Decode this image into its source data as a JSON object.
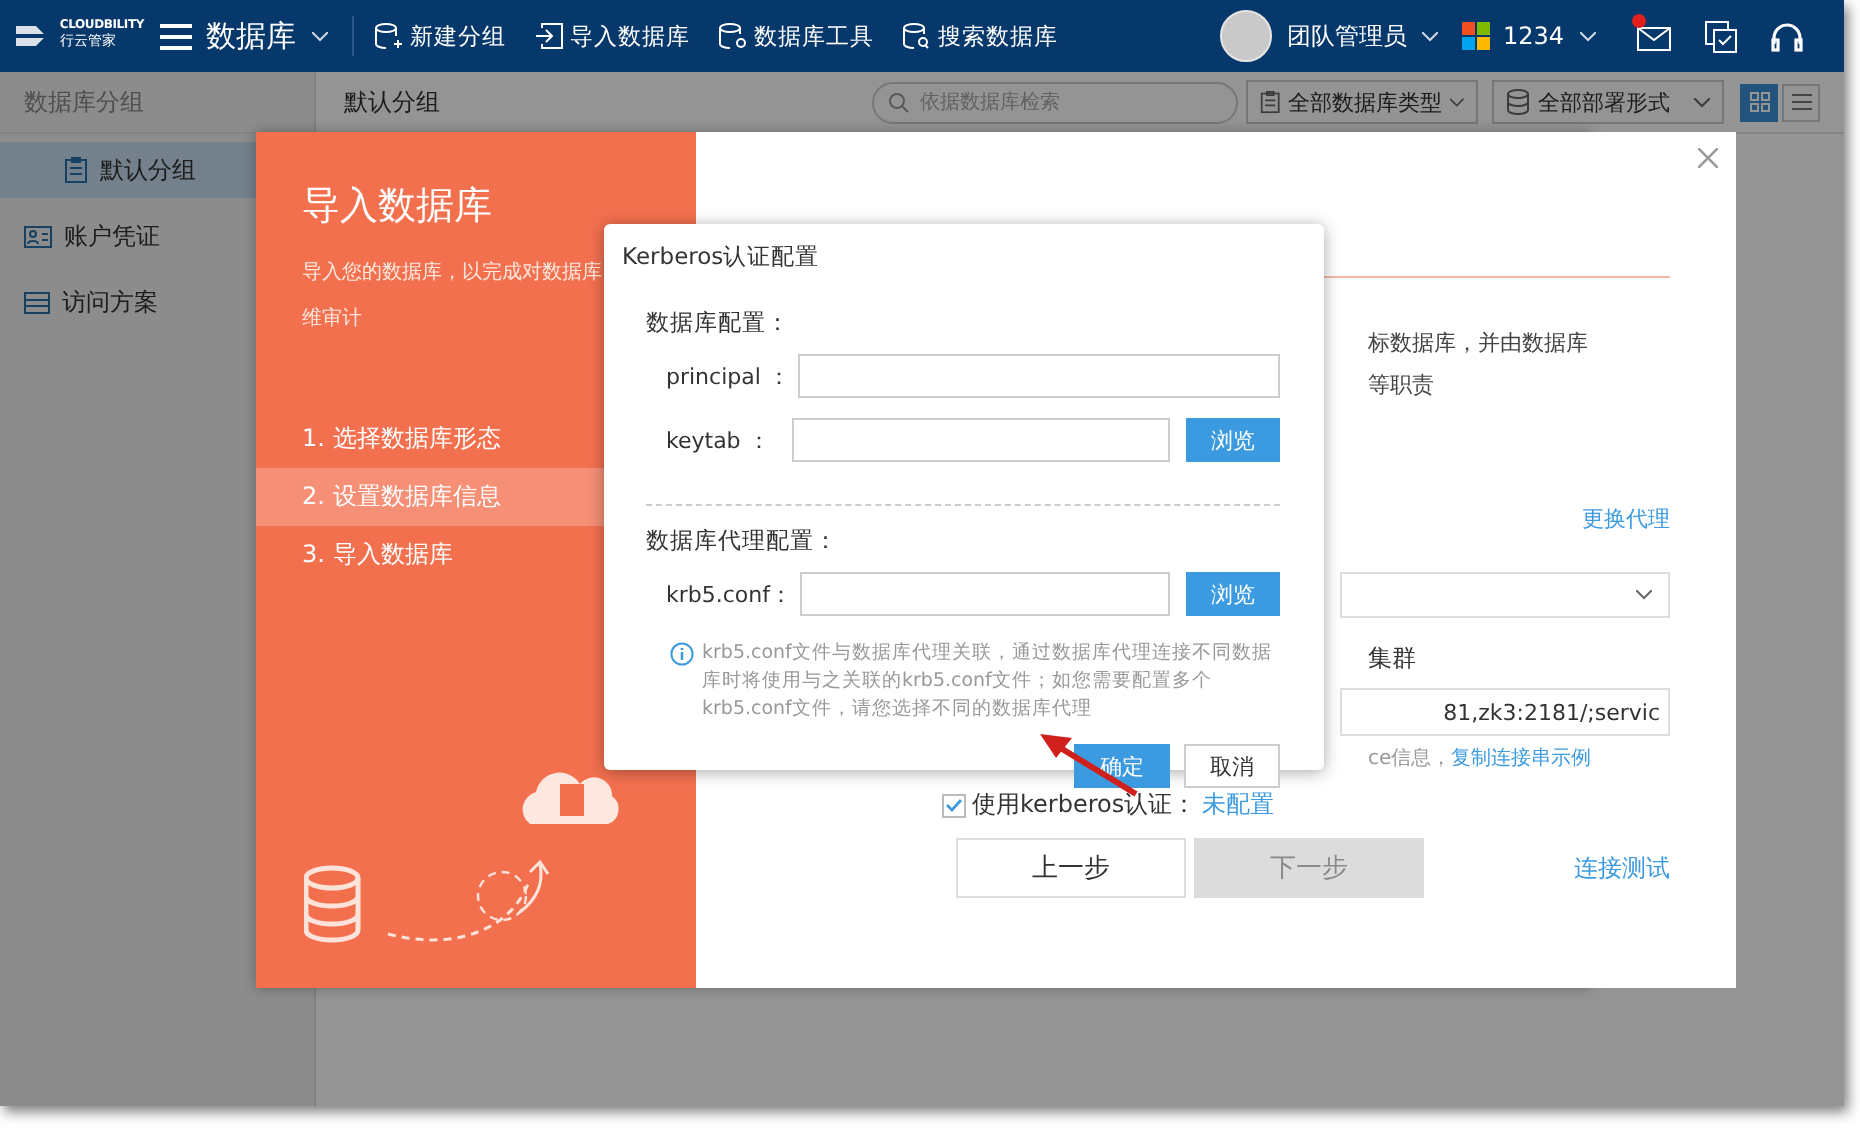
{
  "header": {
    "logo_text": "CLOUDBILITY",
    "logo_subtext": "行云管家",
    "module": "数据库",
    "nav": [
      {
        "kind": "new-group",
        "label": "新建分组"
      },
      {
        "kind": "import",
        "label": "导入数据库"
      },
      {
        "kind": "tools",
        "label": "数据库工具"
      },
      {
        "kind": "search",
        "label": "搜索数据库"
      }
    ],
    "user": "团队管理员",
    "account": "1234",
    "unread": true
  },
  "subbar": {
    "sidebar_title": "数据库分组",
    "group_title": "默认分组",
    "search": {
      "placeholder": "依据数据库检索"
    },
    "filters": [
      {
        "kind": "type",
        "label": "全部数据库类型"
      },
      {
        "kind": "deploy",
        "label": "全部部署形式"
      }
    ],
    "views": [
      {
        "kind": "grid",
        "selected": true
      },
      {
        "kind": "list",
        "selected": false
      }
    ]
  },
  "sidebar": {
    "items": [
      {
        "kind": "group",
        "label": "默认分组",
        "selected": true
      },
      {
        "kind": "credentials",
        "label": "账户凭证",
        "selected": false
      },
      {
        "kind": "access",
        "label": "访问方案",
        "selected": false
      }
    ]
  },
  "wizard": {
    "title": "导入数据库",
    "intro_lines": [
      "导入您的数据库，以完成对数据库",
      "维审计"
    ],
    "steps": [
      {
        "label": "1. 选择数据库形态",
        "selected": false
      },
      {
        "label": "2. 设置数据库信息",
        "selected": true
      },
      {
        "label": "3. 导入数据库",
        "selected": false
      }
    ],
    "partial_lines": [
      "标数据库，并由数据库",
      "等职责"
    ],
    "proxy_link": "更换代理",
    "cluster_label": "集群",
    "connection_value": "81,zk3:2181/;servic",
    "hint_text": "ce信息，",
    "hint_link": "复制连接串示例",
    "kerberos": {
      "checked": true,
      "label": "使用kerberos认证：",
      "link": "未配置"
    },
    "buttons": [
      {
        "label": "上一步",
        "disabled": false
      },
      {
        "label": "下一步",
        "disabled": true
      }
    ],
    "test_link": "连接测试"
  },
  "dialog": {
    "title": "Kerberos认证配置",
    "sections": [
      {
        "title": "数据库配置：",
        "fields": [
          {
            "label": "principal ："
          },
          {
            "label": "keytab ：",
            "browse": "浏览"
          }
        ]
      },
      {
        "title": "数据库代理配置：",
        "fields": [
          {
            "label": "krb5.conf：",
            "browse": "浏览"
          }
        ]
      }
    ],
    "note": "krb5.conf文件与数据库代理关联，通过数据库代理连接不同数据库时将使用与之关联的krb5.conf文件；如您需要配置多个krb5.conf文件，请您选择不同的数据库代理",
    "buttons": [
      {
        "kind": "primary",
        "label": "确定"
      },
      {
        "kind": "secondary",
        "label": "取消"
      }
    ]
  }
}
